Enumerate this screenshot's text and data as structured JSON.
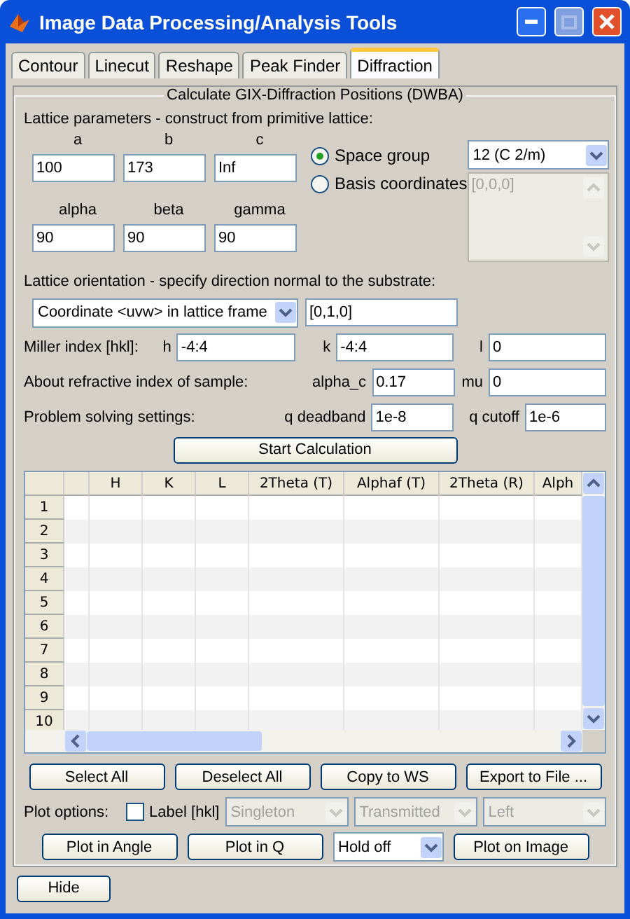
{
  "window": {
    "title": "Image Data Processing/Analysis Tools"
  },
  "tabs": [
    {
      "label": "Contour",
      "selected": false
    },
    {
      "label": "Linecut",
      "selected": false
    },
    {
      "label": "Reshape",
      "selected": false
    },
    {
      "label": "Peak Finder",
      "selected": false
    },
    {
      "label": "Diffraction",
      "selected": true
    }
  ],
  "group_title": "Calculate GIX-Diffraction Positions (DWBA)",
  "lattice": {
    "label": "Lattice parameters - construct from primitive lattice:",
    "params": [
      {
        "label": "a",
        "value": "100"
      },
      {
        "label": "b",
        "value": "173"
      },
      {
        "label": "c",
        "value": "Inf"
      },
      {
        "label": "alpha",
        "value": "90"
      },
      {
        "label": "beta",
        "value": "90"
      },
      {
        "label": "gamma",
        "value": "90"
      }
    ],
    "modes": [
      {
        "label": "Space group",
        "selected": true
      },
      {
        "label": "Basis coordinates",
        "selected": false
      }
    ],
    "space_group": "12 (C 2/m)",
    "basis_coordinates": {
      "value": "[0,0,0]",
      "disabled": true
    }
  },
  "orientation": {
    "label": "Lattice orientation - specify direction normal to the substrate:",
    "mode": "Coordinate <uvw> in lattice frame",
    "value": "[0,1,0]"
  },
  "miller": {
    "label": "Miller index [hkl]:",
    "fields": [
      {
        "label": "h",
        "value": "-4:4"
      },
      {
        "label": "k",
        "value": "-4:4"
      },
      {
        "label": "l",
        "value": "0"
      }
    ]
  },
  "refraction": {
    "label": "About refractive index of sample:",
    "fields": [
      {
        "label": "alpha_c",
        "value": "0.17"
      },
      {
        "label": "mu",
        "value": "0"
      }
    ]
  },
  "solver": {
    "label": "Problem solving settings:",
    "fields": [
      {
        "label": "q deadband",
        "value": "1e-8"
      },
      {
        "label": "q cutoff",
        "value": "1e-6"
      }
    ]
  },
  "start_button": "Start Calculation",
  "table": {
    "columns": [
      "H",
      "K",
      "L",
      "2Theta (T)",
      "Alphaf (T)",
      "2Theta (R)",
      "Alph"
    ],
    "row_numbers": [
      "1",
      "2",
      "3",
      "4",
      "5",
      "6",
      "7",
      "8",
      "9",
      "10"
    ]
  },
  "actions": [
    "Select All",
    "Deselect All",
    "Copy to WS",
    "Export to File ..."
  ],
  "plot_options": {
    "label": "Plot options:",
    "label_hkl": {
      "label": "Label [hkl]",
      "checked": false
    },
    "dropdowns": [
      {
        "value": "Singleton",
        "disabled": true
      },
      {
        "value": "Transmitted",
        "disabled": true
      },
      {
        "value": "Left",
        "disabled": true
      }
    ]
  },
  "plot_buttons": [
    {
      "kind": "button",
      "label": "Plot in Angle"
    },
    {
      "kind": "button",
      "label": "Plot in Q"
    },
    {
      "kind": "dropdown",
      "label": "Hold off"
    },
    {
      "kind": "button",
      "label": "Plot on Image"
    }
  ],
  "hide_button": "Hide"
}
